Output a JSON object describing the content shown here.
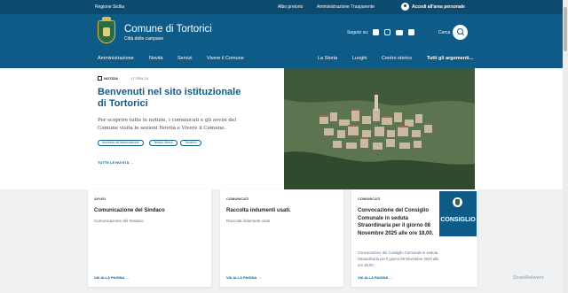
{
  "topbar": {
    "region": "Regione Sicilia",
    "albo": "Albo pretorio",
    "trasparente": "Amministrazione Trasparente",
    "login": "Accedi all'area personale"
  },
  "header": {
    "title": "Comune di Tortorici",
    "subtitle": "Città delle campane",
    "follow": "Seguici su:",
    "search_label": "Cerca",
    "social_icons": [
      "facebook-icon",
      "instagram-icon",
      "youtube-icon",
      "x-icon"
    ]
  },
  "nav": {
    "left": [
      "Amministrazione",
      "Novità",
      "Servizi",
      "Vivere il Comune"
    ],
    "right": [
      "La Storia",
      "Luoghi",
      "Centro storico"
    ],
    "all": "Tutti gli argomenti..."
  },
  "hero": {
    "tag": "NOTIZIA",
    "date": "17 GEN 24",
    "title": "Benvenuti nel sito istituzionale di Tortorici",
    "text": "Per scoprire tutte le notizie, i comunicati e gli avvisi del Comune visita le sezioni Novità e Vivere il Comune.",
    "chips": [
      "Accesso all'informazione",
      "Tempo libero",
      "Turismo"
    ],
    "cta": "TUTTE LE NOVITÀ"
  },
  "cards": [
    {
      "category": "AVVISI",
      "title": "Comunicazione del Sindaco",
      "desc": "Comunicazione del Sindaco",
      "link": "VAI ALLA PAGINA"
    },
    {
      "category": "COMUNICATI",
      "title": "Raccolta indumenti usati.",
      "desc": "Raccolta indumenti usati.",
      "link": "VAI ALLA PAGINA"
    },
    {
      "category": "COMUNICATI",
      "title": "Convocazione del Consiglio Comunale in seduta Straordinaria per il giorno 08 Novembre 2025 alle ore 18,00.",
      "desc": "Convocazione del Consiglio Comunale in seduta Straordinaria per il giorno 08 Novembre 2025 alle ore 18,00",
      "link": "VAI ALLA PAGINA",
      "badge": "CONSIGLIO"
    }
  ],
  "watermark": "ScanMalware",
  "colors": {
    "brand": "#0f5b88",
    "topbar": "#0d4a70"
  }
}
